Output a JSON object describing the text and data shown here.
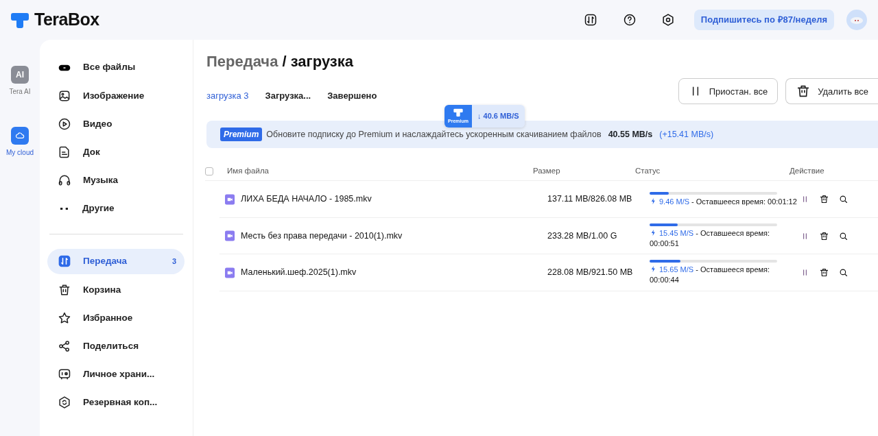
{
  "header": {
    "logo": "TeraBox",
    "subscribe": "Подпишитесь по ₽87/неделя"
  },
  "rail": [
    {
      "icon_text": "AI",
      "label": "Tera AI",
      "selected": false
    },
    {
      "label": "My cloud",
      "selected": true
    }
  ],
  "sidebar": {
    "items": [
      {
        "label": "Все файлы",
        "selected": false
      },
      {
        "label": "Изображение",
        "selected": false
      },
      {
        "label": "Видео",
        "selected": false
      },
      {
        "label": "Док",
        "selected": false
      },
      {
        "label": "Музыка",
        "selected": false
      },
      {
        "label": "Другие",
        "selected": false
      }
    ],
    "items2": [
      {
        "label": "Передача",
        "selected": true,
        "count": "3"
      },
      {
        "label": "Корзина",
        "selected": false
      },
      {
        "label": "Избранное",
        "selected": false
      },
      {
        "label": "Поделиться",
        "selected": false
      },
      {
        "label": "Личное храни...",
        "selected": false
      },
      {
        "label": "Резервная коп...",
        "selected": false
      }
    ]
  },
  "title": {
    "parent": "Передача",
    "separator": "/",
    "current": "загрузка"
  },
  "tabs": [
    {
      "label": "загрузка 3",
      "selected": true
    },
    {
      "label": "Загрузка...",
      "selected": false
    },
    {
      "label": "Завершено",
      "selected": false
    }
  ],
  "buttons": {
    "pause_all": "Приостан. все",
    "delete_all": "Удалить все"
  },
  "speed_badge": {
    "tag": "Premium",
    "speed": "↓ 40.6 MB/S"
  },
  "banner": {
    "tag": "Premium",
    "text": "Обновите подписку до Premium и наслаждайтесь ускоренным скачиванием файлов",
    "speed": "40.55 MB/s",
    "boost": "(+15.41 MB/s)"
  },
  "table": {
    "select_all": {
      "checked": false
    },
    "columns": [
      "Имя файла",
      "Размер",
      "Статус",
      "Действие"
    ],
    "rows": [
      {
        "name": "ЛИХА БЕДА НАЧАЛО - 1985.mkv",
        "size": "137.11 MB/826.08 MB",
        "level": 0.15,
        "speed": "9.46 M/S",
        "remaining": "- Оставшееся время: 00:01:12"
      },
      {
        "name": "Месть без права передачи - 2010(1).mkv",
        "size": "233.28 MB/1.00 G",
        "level": 0.22,
        "speed": "15.45 M/S",
        "remaining": "- Оставшееся время: 00:00:51"
      },
      {
        "name": "Маленький.шеф.2025(1).mkv",
        "size": "228.08 MB/921.50 MB",
        "level": 0.24,
        "speed": "15.65 M/S",
        "remaining": "- Оставшееся время: 00:00:44"
      }
    ]
  }
}
